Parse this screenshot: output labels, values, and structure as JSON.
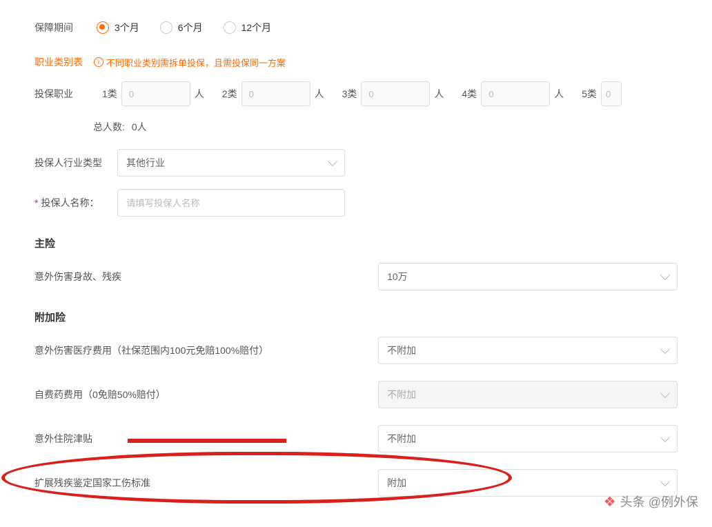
{
  "period": {
    "label": "保障期间",
    "options": [
      "3个月",
      "6个月",
      "12个月"
    ],
    "selected": 0
  },
  "occupation": {
    "table_link": "职业类别表",
    "tip": "不同职业类别需拆单投保，且需投保同一方案",
    "row_label": "投保职业",
    "categories": [
      "1类",
      "2类",
      "3类",
      "4类",
      "5类"
    ],
    "placeholder": "0",
    "unit": "人",
    "total_label": "总人数:",
    "total_value": "0人"
  },
  "industry": {
    "label": "投保人行业类型",
    "selected": "其他行业"
  },
  "applicant": {
    "label": "投保人名称：",
    "placeholder": "请填写投保人名称"
  },
  "main_insurance": {
    "title": "主险",
    "items": [
      {
        "label": "意外伤害身故、残疾",
        "value": "10万",
        "disabled": false
      }
    ]
  },
  "addon_insurance": {
    "title": "附加险",
    "items": [
      {
        "label": "意外伤害医疗费用（社保范围内100元免赔100%赔付）",
        "value": "不附加",
        "disabled": false
      },
      {
        "label": "自费药费用（0免赔50%赔付）",
        "value": "不附加",
        "disabled": true
      },
      {
        "label": "意外住院津贴",
        "value": "不附加",
        "disabled": false
      },
      {
        "label": "扩展残疾鉴定国家工伤标准",
        "value": "附加",
        "disabled": false
      }
    ]
  },
  "watermark": "头条 @例外保"
}
